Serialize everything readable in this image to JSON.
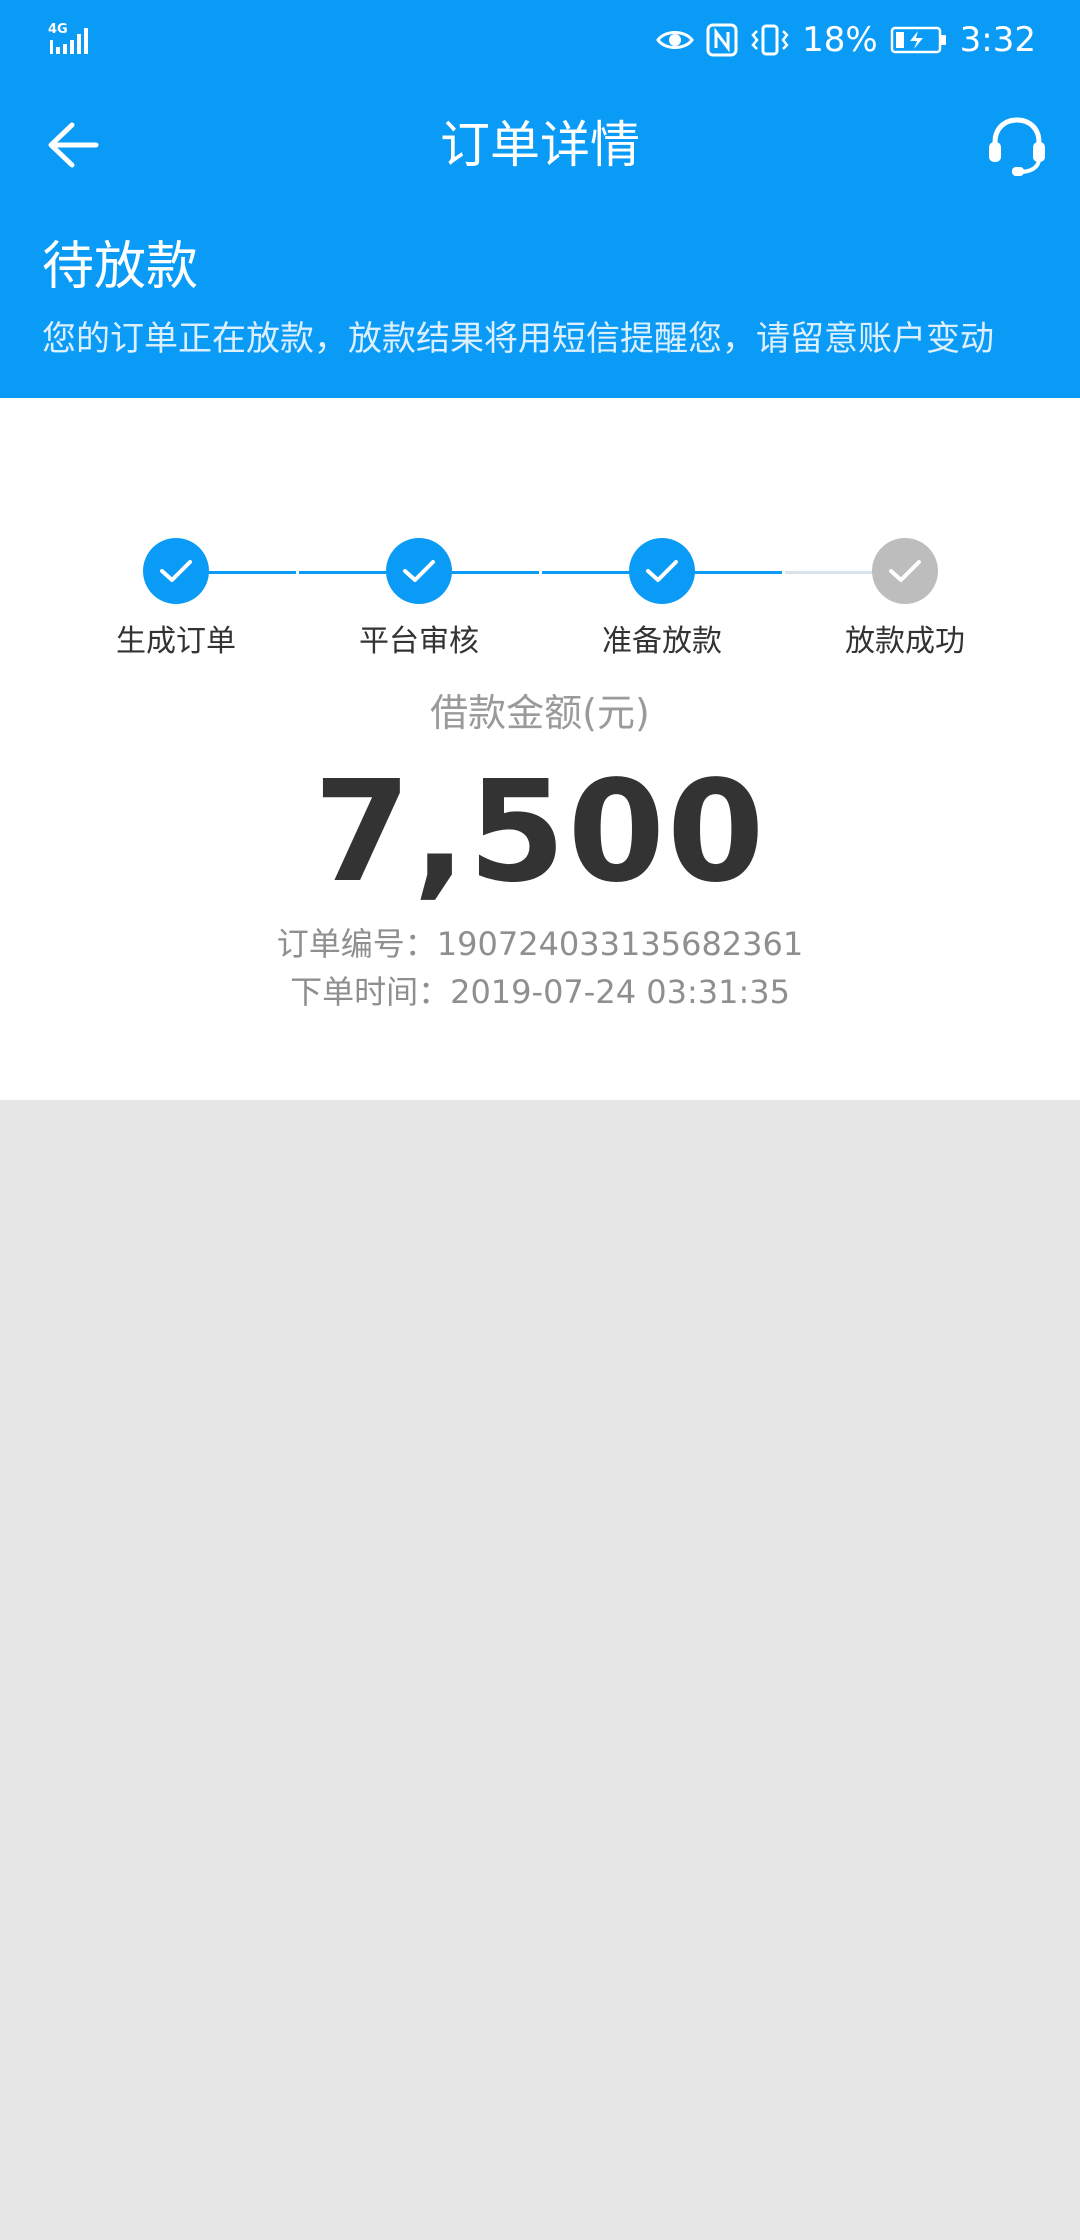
{
  "status_bar": {
    "network": "4G",
    "battery": "18%",
    "time": "3:32"
  },
  "header": {
    "title": "订单详情"
  },
  "status": {
    "title": "待放款",
    "description": "您的订单正在放款，放款结果将用短信提醒您，请留意账户变动"
  },
  "steps": [
    {
      "label": "生成订单",
      "state": "done"
    },
    {
      "label": "平台审核",
      "state": "done"
    },
    {
      "label": "准备放款",
      "state": "done"
    },
    {
      "label": "放款成功",
      "state": "pending"
    }
  ],
  "loan": {
    "amount_label": "借款金额(元)",
    "amount": "7,500",
    "order_no_label": "订单编号：",
    "order_no": "190724033135682361",
    "order_time_label": "下单时间：",
    "order_time": "2019-07-24 03:31:35"
  },
  "colors": {
    "primary": "#0a9bf6",
    "pending": "#bdbdbd",
    "background": "#e6e6e6"
  },
  "icons": {
    "back": "arrow-left-icon",
    "service": "headset-icon",
    "check": "check-icon"
  }
}
